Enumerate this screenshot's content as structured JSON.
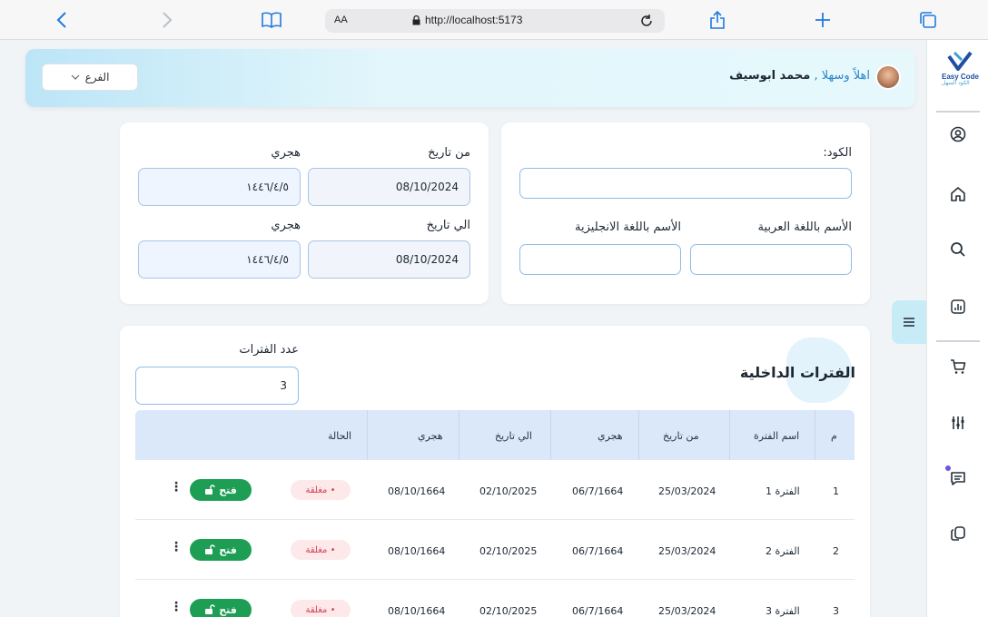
{
  "browser": {
    "text_size_label": "AA",
    "url": "http://localhost:5173"
  },
  "icons": {
    "back": "chevron-left-icon",
    "forward": "chevron-right-icon",
    "bookmarks": "book-icon",
    "share": "share-icon",
    "new_tab": "plus-icon",
    "tabs": "tabs-icon"
  },
  "sidebar": {
    "logo_text_en": "Easy Code",
    "logo_text_ar": "الكود السهل",
    "items": [
      {
        "icon": "user-circle-icon"
      },
      {
        "icon": "home-icon"
      },
      {
        "icon": "search-icon"
      },
      {
        "icon": "chart-icon"
      },
      {
        "icon": "cart-icon"
      },
      {
        "icon": "sliders-icon"
      },
      {
        "icon": "message-icon"
      },
      {
        "icon": "copy-icon"
      }
    ]
  },
  "header": {
    "branch_label": "الفرع",
    "greeting": "اهلاً وسهلا ,",
    "user_name": "محمد ابوسيف"
  },
  "code_card": {
    "code_label": "الكود:",
    "code_value": "",
    "name_ar_label": "الأسم باللغة العربية",
    "name_ar_value": "",
    "name_en_label": "الأسم باللغة الانجليزية",
    "name_en_value": ""
  },
  "date_card": {
    "from_label": "من تاريخ",
    "from_value": "08/10/2024",
    "from_hijri_label": "هجري",
    "from_hijri_value": "١٤٤٦/٤/٥",
    "to_label": "الي تاريخ",
    "to_value": "08/10/2024",
    "to_hijri_label": "هجري",
    "to_hijri_value": "١٤٤٦/٤/٥"
  },
  "periods": {
    "title": "الفترات الداخلية",
    "count_label": "عدد الفترات",
    "count_value": "3",
    "columns": {
      "index": "م",
      "name": "اسم الفترة",
      "from": "من تاريخ",
      "from_hijri": "هجري",
      "to": "الي تاريخ",
      "to_hijri": "هجري",
      "status": "الحالة"
    },
    "rows": [
      {
        "index": "1",
        "name": "الفترة 1",
        "from": "25/03/2024",
        "from_hijri": "06/7/1664",
        "to": "02/10/2025",
        "to_hijri": "08/10/1664",
        "status": "مغلقة",
        "action": "فتح"
      },
      {
        "index": "2",
        "name": "الفترة 2",
        "from": "25/03/2024",
        "from_hijri": "06/7/1664",
        "to": "02/10/2025",
        "to_hijri": "08/10/1664",
        "status": "مغلقة",
        "action": "فتح"
      },
      {
        "index": "3",
        "name": "الفترة 3",
        "from": "25/03/2024",
        "from_hijri": "06/7/1664",
        "to": "02/10/2025",
        "to_hijri": "08/10/1664",
        "status": "مغلقة",
        "action": "فتح"
      }
    ],
    "colors": {
      "open_button": "#1e9e55",
      "closed_badge_bg": "#fde8ea",
      "closed_badge_text": "#d64553",
      "table_header_bg": "#dbe8fa"
    }
  }
}
